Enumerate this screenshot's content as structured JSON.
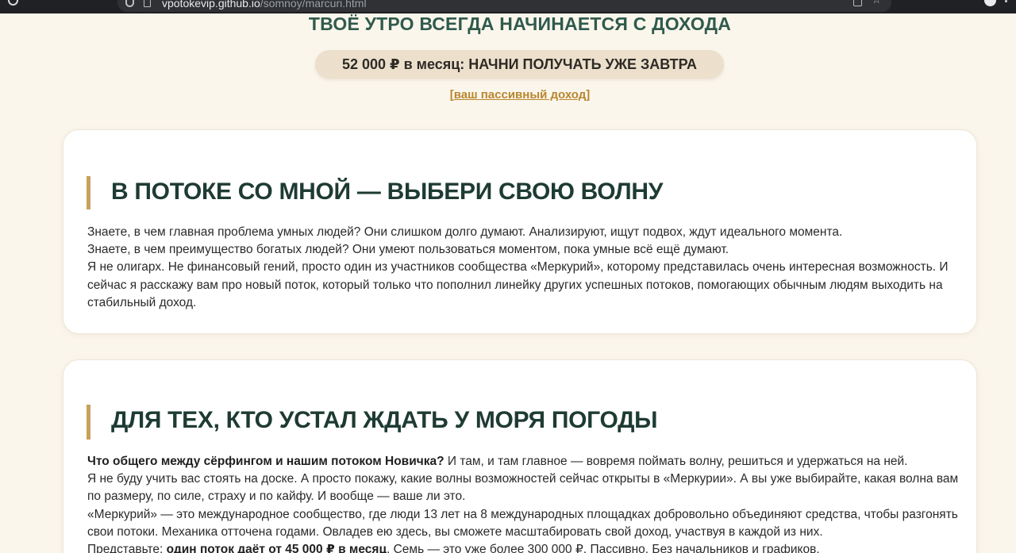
{
  "browser": {
    "url_host": "vpotokevip.github.io",
    "url_path": "/somnoy/marcuri.html"
  },
  "hero": {
    "title": "ТВОЁ УТРО ВСЕГДА НАЧИНАЕТСЯ С ДОХОДА",
    "pill": "52 000 ₽ в месяц: НАЧНИ ПОЛУЧАТЬ УЖЕ ЗАВТРА",
    "link_open": "[",
    "link_text": "ваш пассивный доход",
    "link_close": "]"
  },
  "section1": {
    "heading": "В ПОТОКЕ СО МНОЙ — ВЫБЕРИ СВОЮ ВОЛНУ",
    "p1": "Знаете, в чем главная проблема умных людей? Они слишком долго думают. Анализируют, ищут подвох, ждут идеального момента.",
    "p2": "Знаете, в чем преимущество богатых людей? Они умеют пользоваться моментом, пока умные всё ещё думают.",
    "p3": "Я не олигарх. Не финансовый гений, просто один из участников сообщества «Меркурий», которому представилась очень интересная возможность. И сейчас я расскажу вам про новый поток, который только что пополнил линейку других успешных потоков, помогающих обычным людям выходить на стабильный доход."
  },
  "section2": {
    "heading": "ДЛЯ ТЕХ, КТО УСТАЛ ЖДАТЬ У МОРЯ ПОГОДЫ",
    "p1_bold": "Что общего между сёрфингом и нашим потоком Новичка?",
    "p1_rest": " И там, и там главное — вовремя поймать волну, решиться и удержаться на ней.",
    "p2": "Я не буду учить вас стоять на доске. А просто покажу, какие волны возможностей сейчас открыты в «Меркурии». А вы уже выбирайте, какая волна вам по размеру, по силе, страху и по кайфу. И вообще — ваше ли это.",
    "p3": "«Меркурий» — это международное сообщество, где люди 13 лет на 8 международных площадках добровольно объединяют средства, чтобы разгонять свои потоки. Механика отточена годами. Овладев ею здесь, вы сможете масштабировать свой доход, участвуя в каждой из них.",
    "p4_start": "Представьте: ",
    "p4_bold": "один поток даёт от 45 000 ₽ в месяц",
    "p4_rest": ". Семь — это уже более 300 000 ₽. Пассивно. Без начальников и графиков."
  }
}
